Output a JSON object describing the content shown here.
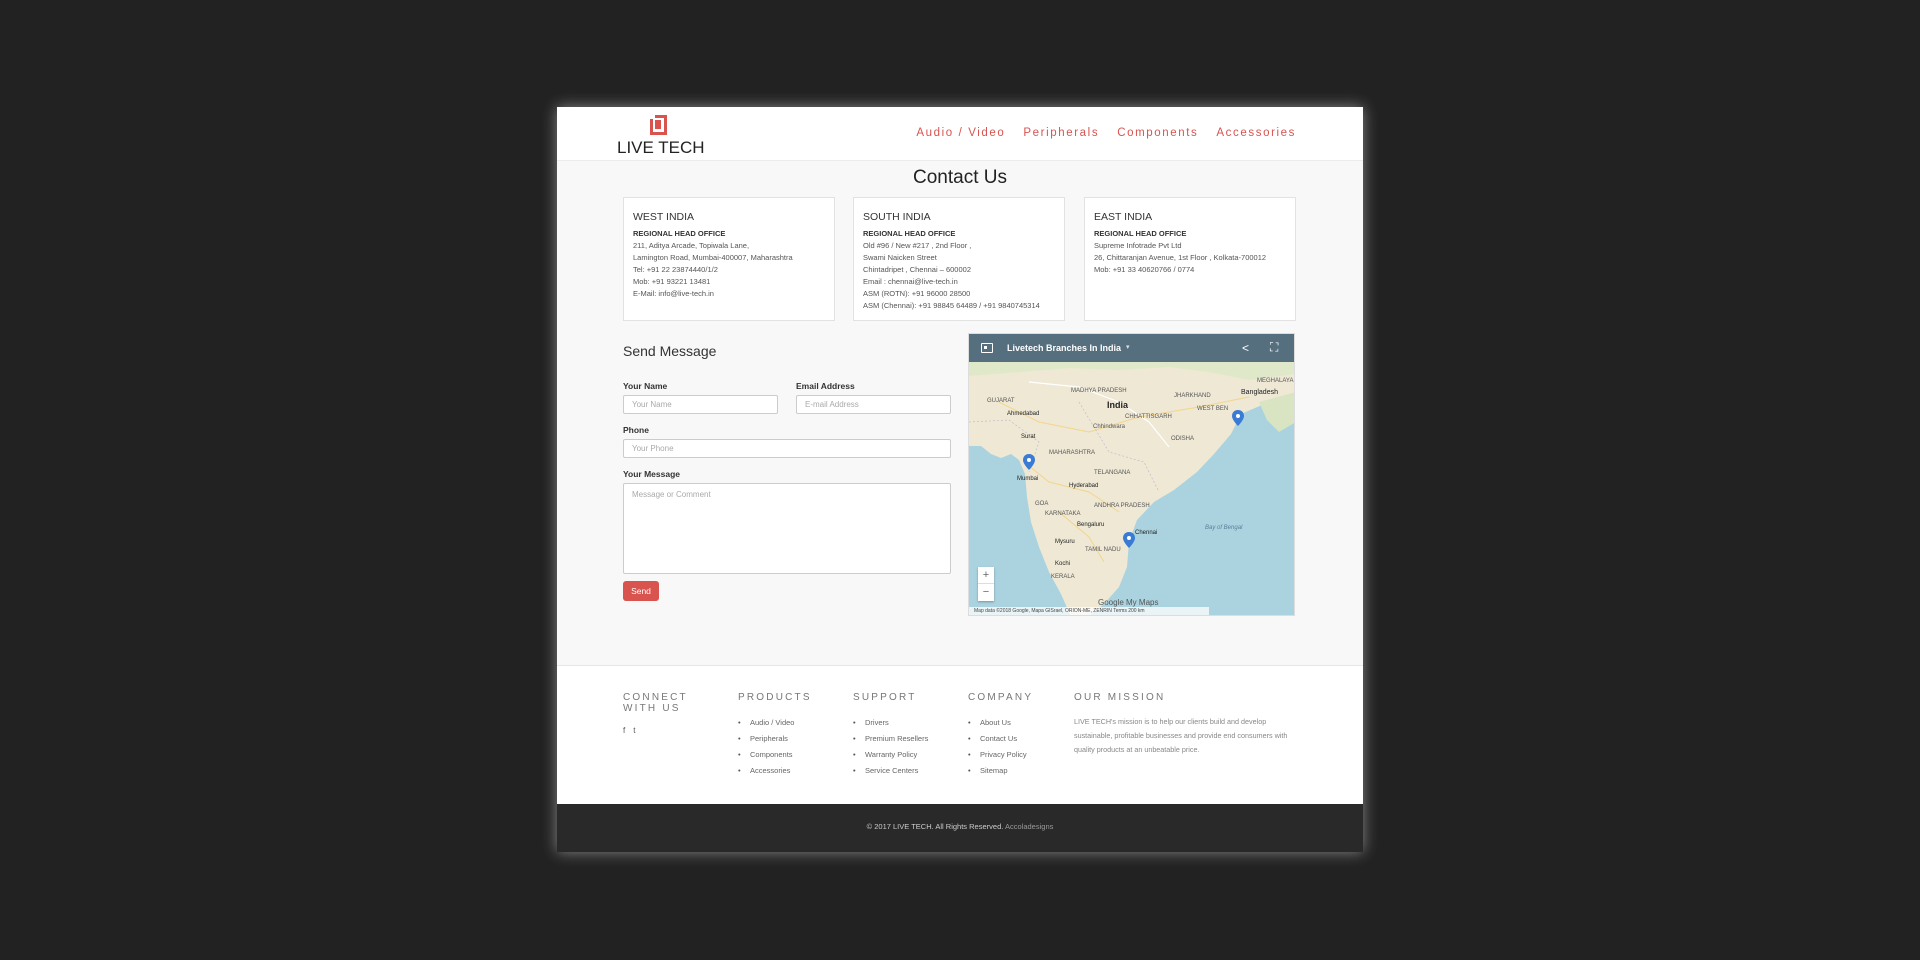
{
  "brand": {
    "name": "LIVE TECH",
    "accent_color": "#d9534f"
  },
  "nav": [
    {
      "label": "Audio / Video"
    },
    {
      "label": "Peripherals"
    },
    {
      "label": "Components"
    },
    {
      "label": "Accessories"
    }
  ],
  "page_title": "Contact Us",
  "offices": [
    {
      "region": "WEST INDIA",
      "subtitle": "REGIONAL HEAD OFFICE",
      "lines": [
        "211, Aditya Arcade, Topiwala Lane,",
        "Lamington Road, Mumbai-400007, Maharashtra",
        "Tel: +91 22 23874440/1/2",
        "Mob: +91 93221 13481",
        "E-Mail: info@live-tech.in"
      ]
    },
    {
      "region": "SOUTH INDIA",
      "subtitle": "REGIONAL HEAD OFFICE",
      "lines": [
        "Old #96 / New #217 , 2nd Floor ,",
        "Swami Naicken Street",
        "Chintadripet , Chennai – 600002",
        "Email : chennai@live-tech.in",
        "ASM (ROTN): +91 96000 28500",
        "ASM (Chennai): +91 98845 64489 / +91 9840745314"
      ]
    },
    {
      "region": "EAST INDIA",
      "subtitle": "REGIONAL HEAD OFFICE",
      "lines": [
        "Supreme Infotrade Pvt Ltd",
        "26, Chittaranjan Avenue, 1st Floor , Kolkata-700012",
        "Mob: +91 33 40620766 / 0774"
      ]
    }
  ],
  "form": {
    "title": "Send Message",
    "name_label": "Your Name",
    "name_placeholder": "Your Name",
    "email_label": "Email Address",
    "email_placeholder": "E-mail Address",
    "phone_label": "Phone",
    "phone_placeholder": "Your Phone",
    "message_label": "Your Message",
    "message_placeholder": "Message or Comment",
    "send_label": "Send"
  },
  "map": {
    "title": "Livetech Branches In India",
    "zoom_in": "+",
    "zoom_out": "−",
    "google_label": "Google My Maps",
    "attribution": "Map data ©2018 Google, Mapa GISrael, ORION-ME, ZENRIN    Terms    200 km",
    "labels": [
      "GUJARAT",
      "MADHYA PRADESH",
      "JHARKHAND",
      "India",
      "Bangladesh",
      "MEGHALAYA",
      "Ahmedabad",
      "Chhindwara",
      "WEST BEN",
      "CHHATTISGARH",
      "Surat",
      "ODISHA",
      "Mumbai",
      "MAHARASHTRA",
      "TELANGANA",
      "Hyderabad",
      "GOA",
      "ANDHRA PRADESH",
      "KARNATAKA",
      "Bengaluru",
      "Chennai",
      "Bay of Bengal",
      "Mysuru",
      "TAMIL NADU",
      "Kochi",
      "KERALA"
    ]
  },
  "footer": {
    "connect_title": "CONNECT WITH US",
    "social": [
      "f",
      "t"
    ],
    "products_title": "PRODUCTS",
    "products": [
      "Audio / Video",
      "Peripherals",
      "Components",
      "Accessories"
    ],
    "support_title": "SUPPORT",
    "support": [
      "Drivers",
      "Premium Resellers",
      "Warranty Policy",
      "Service Centers"
    ],
    "company_title": "COMPANY",
    "company": [
      "About Us",
      "Contact Us",
      "Privacy Policy",
      "Sitemap"
    ],
    "mission_title": "OUR MISSION",
    "mission_text": "LIVE TECH's mission is to help our clients build and develop sustainable, profitable businesses and provide end consumers with quality products at an unbeatable price."
  },
  "copyright": {
    "text": "© 2017 LIVE TECH. All Rights Reserved.",
    "credit": "Accoladesigns"
  }
}
